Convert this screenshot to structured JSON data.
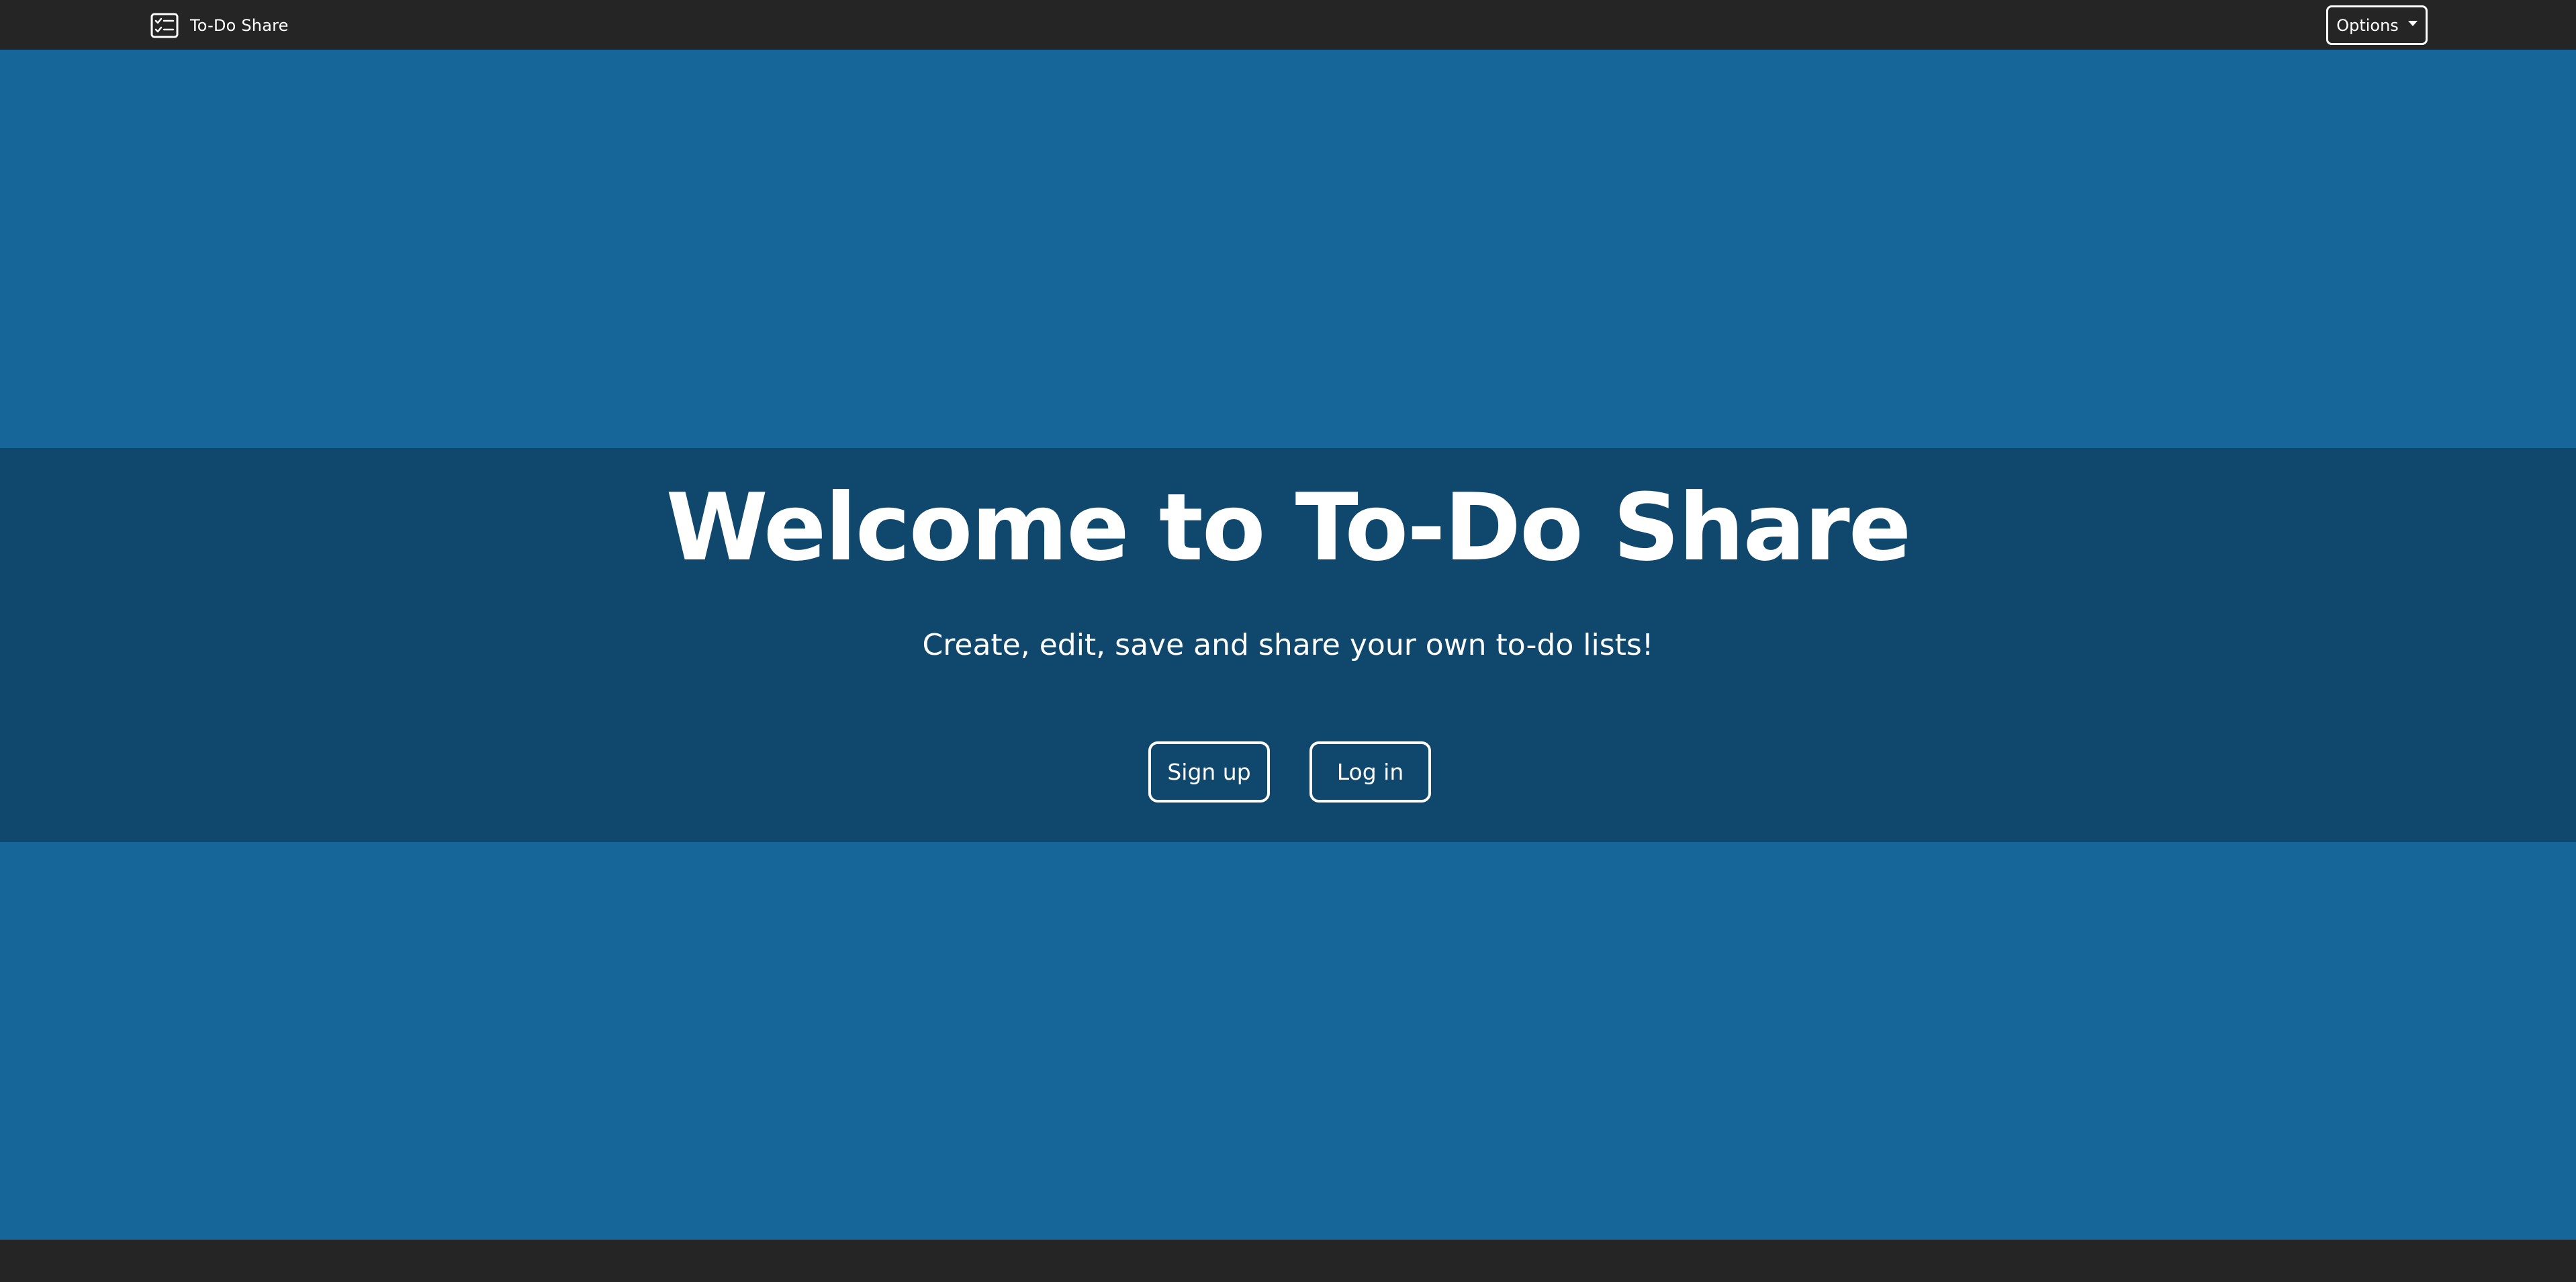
{
  "navbar": {
    "brand_label": "To-Do Share",
    "brand_icon": "checklist-icon",
    "options_label": "Options",
    "options_icon": "caret-down-icon"
  },
  "hero": {
    "title": "Welcome to To-Do Share",
    "subtitle": "Create, edit, save and share your own to-do lists!",
    "signup_label": "Sign up",
    "login_label": "Log in"
  },
  "colors": {
    "page_background": "#176699",
    "hero_background": "#10486d",
    "navbar_background": "#252525",
    "footer_background": "#252525",
    "text": "#ffffff"
  }
}
